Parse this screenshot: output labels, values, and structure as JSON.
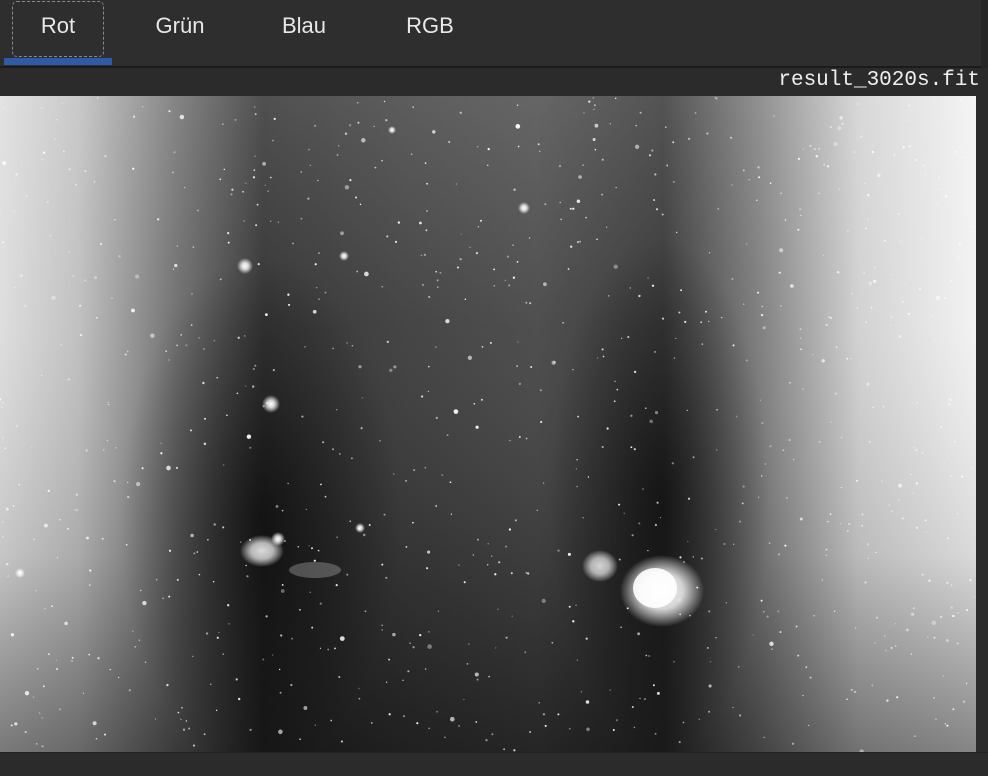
{
  "tabs": [
    {
      "label": "Rot",
      "active": true
    },
    {
      "label": "Grün",
      "active": false
    },
    {
      "label": "Blau",
      "active": false
    },
    {
      "label": "RGB",
      "active": false
    }
  ],
  "viewer": {
    "filename": "result_3020s.fit",
    "channel_shown": "Rot",
    "colors": {
      "accent": "#2e5ba9",
      "background": "#2b2b2b",
      "tab_text": "#e8e8e8"
    }
  }
}
